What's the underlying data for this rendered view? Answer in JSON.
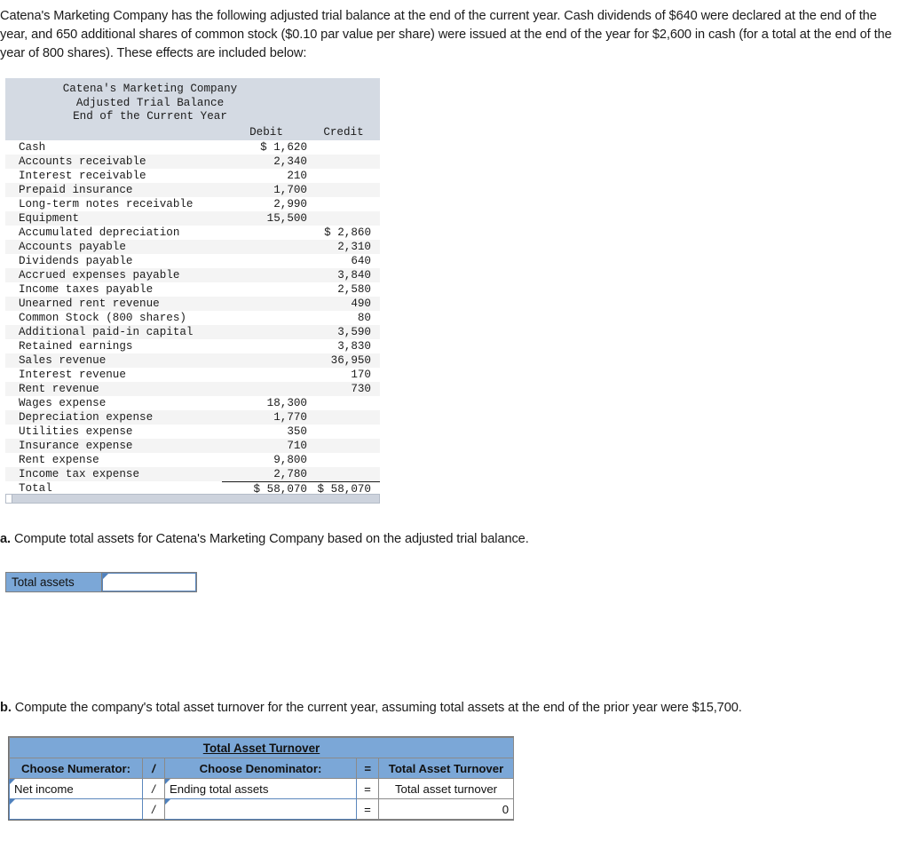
{
  "intro": "Catena's Marketing Company has the following adjusted trial balance at the end of the current year. Cash dividends of $640 were declared at the end of the year, and 650 additional shares of common stock ($0.10 par value per share) were issued at the end of the year for $2,600 in cash (for a total at the end of the year of 800 shares). These effects are included below:",
  "trial_balance": {
    "title_line1": "Catena's Marketing Company",
    "title_line2": "Adjusted Trial Balance",
    "title_line3": "End of the Current Year",
    "columns": {
      "account": "",
      "debit": "Debit",
      "credit": "Credit"
    },
    "rows": [
      {
        "account": "Cash",
        "debit": "$ 1,620",
        "credit": ""
      },
      {
        "account": "Accounts receivable",
        "debit": "2,340",
        "credit": ""
      },
      {
        "account": "Interest receivable",
        "debit": "210",
        "credit": ""
      },
      {
        "account": "Prepaid insurance",
        "debit": "1,700",
        "credit": ""
      },
      {
        "account": "Long-term notes receivable",
        "debit": "2,990",
        "credit": ""
      },
      {
        "account": "Equipment",
        "debit": "15,500",
        "credit": ""
      },
      {
        "account": "Accumulated depreciation",
        "debit": "",
        "credit": "$ 2,860"
      },
      {
        "account": "Accounts payable",
        "debit": "",
        "credit": "2,310"
      },
      {
        "account": "Dividends payable",
        "debit": "",
        "credit": "640"
      },
      {
        "account": "Accrued expenses payable",
        "debit": "",
        "credit": "3,840"
      },
      {
        "account": "Income taxes payable",
        "debit": "",
        "credit": "2,580"
      },
      {
        "account": "Unearned rent revenue",
        "debit": "",
        "credit": "490"
      },
      {
        "account": "Common Stock (800 shares)",
        "debit": "",
        "credit": "80"
      },
      {
        "account": "Additional paid-in capital",
        "debit": "",
        "credit": "3,590"
      },
      {
        "account": "Retained earnings",
        "debit": "",
        "credit": "3,830"
      },
      {
        "account": "Sales revenue",
        "debit": "",
        "credit": "36,950"
      },
      {
        "account": "Interest revenue",
        "debit": "",
        "credit": "170"
      },
      {
        "account": "Rent revenue",
        "debit": "",
        "credit": "730"
      },
      {
        "account": "Wages expense",
        "debit": "18,300",
        "credit": ""
      },
      {
        "account": "Depreciation expense",
        "debit": "1,770",
        "credit": ""
      },
      {
        "account": "Utilities expense",
        "debit": "350",
        "credit": ""
      },
      {
        "account": "Insurance expense",
        "debit": "710",
        "credit": ""
      },
      {
        "account": "Rent expense",
        "debit": "9,800",
        "credit": ""
      },
      {
        "account": "Income tax expense",
        "debit": "2,780",
        "credit": ""
      }
    ],
    "total": {
      "account": "Total",
      "debit": "$ 58,070",
      "credit": "$ 58,070"
    }
  },
  "question_a": {
    "marker": "a.",
    "text": "Compute total assets for Catena's Marketing Company based on the adjusted trial balance.",
    "label": "Total assets",
    "value": "",
    "placeholder": ""
  },
  "question_b": {
    "marker": "b.",
    "text": "Compute the company's total asset turnover for the current year, assuming total assets at the end of the prior year were $15,700.",
    "table": {
      "title": "Total Asset Turnover",
      "headers": {
        "numerator": "Choose Numerator:",
        "divide": "/",
        "denominator": "Choose Denominator:",
        "equals": "=",
        "result": "Total Asset Turnover"
      },
      "rows": [
        {
          "numerator": "Net income",
          "divide": "/",
          "denominator": "Ending total assets",
          "equals": "=",
          "result": "Total asset turnover"
        },
        {
          "numerator": "",
          "divide": "/",
          "denominator": "",
          "equals": "=",
          "result": "0"
        }
      ]
    }
  },
  "colors": {
    "header_blue": "#7ba7d7",
    "table_header_gray": "#d4dae3",
    "row_stripe": "#f4f4f4",
    "cell_border_blue": "#5b87bd",
    "marker_blue": "#4f81bd"
  }
}
